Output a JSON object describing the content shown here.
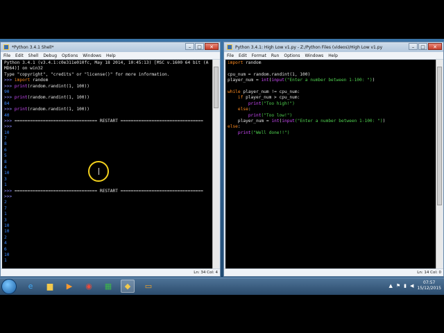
{
  "shell_window": {
    "title": "*Python 3.4.1 Shell*",
    "menu": [
      "File",
      "Edit",
      "Shell",
      "Debug",
      "Options",
      "Windows",
      "Help"
    ],
    "lines": [
      [
        [
          "t",
          "Python 3.4.1 (v3.4.1:c0e311e010fc, May 18 2014, 10:45:13) [MSC v.1600 64 bit (A"
        ]
      ],
      [
        [
          "t",
          "MD64)] on win32"
        ]
      ],
      [
        [
          "t",
          "Type \"copyright\", \"credits\" or \"license()\" for more information."
        ]
      ],
      [
        [
          "prompt",
          ">>> "
        ],
        [
          "kw",
          "import"
        ],
        [
          "t",
          " random"
        ]
      ],
      [
        [
          "prompt",
          ">>> "
        ],
        [
          "bi",
          "print"
        ],
        [
          "t",
          "(random.randint(1, 100))"
        ]
      ],
      [
        [
          "out",
          "90"
        ]
      ],
      [
        [
          "prompt",
          ">>> "
        ],
        [
          "bi",
          "print"
        ],
        [
          "t",
          "(random.randint(1, 100))"
        ]
      ],
      [
        [
          "out",
          "84"
        ]
      ],
      [
        [
          "prompt",
          ">>> "
        ],
        [
          "bi",
          "print"
        ],
        [
          "t",
          "(random.randint(1, 100))"
        ]
      ],
      [
        [
          "out",
          "40"
        ]
      ],
      [
        [
          "prompt",
          ">>> "
        ],
        [
          "t",
          "================================ RESTART ================================"
        ]
      ],
      [
        [
          "prompt",
          ">>> "
        ]
      ],
      [
        [
          "out",
          "10"
        ]
      ],
      [
        [
          "out",
          "7"
        ]
      ],
      [
        [
          "out",
          "8"
        ]
      ],
      [
        [
          "out",
          "6"
        ]
      ],
      [
        [
          "out",
          "5"
        ]
      ],
      [
        [
          "out",
          "8"
        ]
      ],
      [
        [
          "out",
          "4"
        ]
      ],
      [
        [
          "out",
          "10"
        ]
      ],
      [
        [
          "out",
          "3"
        ]
      ],
      [
        [
          "out",
          "1"
        ]
      ],
      [
        [
          "prompt",
          ">>> "
        ],
        [
          "t",
          "================================ RESTART ================================"
        ]
      ],
      [
        [
          "prompt",
          ">>> "
        ]
      ],
      [
        [
          "out",
          "2"
        ]
      ],
      [
        [
          "out",
          "7"
        ]
      ],
      [
        [
          "out",
          "1"
        ]
      ],
      [
        [
          "out",
          "3"
        ]
      ],
      [
        [
          "out",
          "10"
        ]
      ],
      [
        [
          "out",
          "10"
        ]
      ],
      [
        [
          "out",
          "2"
        ]
      ],
      [
        [
          "out",
          "4"
        ]
      ],
      [
        [
          "out",
          "6"
        ]
      ],
      [
        [
          "out",
          "10"
        ]
      ],
      [
        [
          "out",
          "1"
        ]
      ],
      [
        [
          "t",
          ""
        ]
      ],
      [
        [
          "prompt",
          ">>> "
        ]
      ]
    ],
    "status": "Ln: 34 Col: 4"
  },
  "editor_window": {
    "title": "Python 3.4.1: High Low v1.py - Z:/Python Files (videos)/High Low v1.py",
    "menu": [
      "File",
      "Edit",
      "Format",
      "Run",
      "Options",
      "Windows",
      "Help"
    ],
    "lines": [
      [
        [
          "kw",
          "import"
        ],
        [
          "t",
          " random"
        ]
      ],
      [
        [
          "t",
          ""
        ]
      ],
      [
        [
          "t",
          "cpu_num = random.randint(1, 100)"
        ]
      ],
      [
        [
          "t",
          "player_num = "
        ],
        [
          "bi",
          "int"
        ],
        [
          "t",
          "("
        ],
        [
          "bi",
          "input"
        ],
        [
          "str",
          "(\"Enter a number between 1-100: \")"
        ],
        [
          "t",
          ")"
        ]
      ],
      [
        [
          "t",
          ""
        ]
      ],
      [
        [
          "kw",
          "while"
        ],
        [
          "t",
          " player_num != cpu_num:"
        ]
      ],
      [
        [
          "t",
          "    "
        ],
        [
          "kw",
          "if"
        ],
        [
          "t",
          " player_num > cpu_num:"
        ]
      ],
      [
        [
          "t",
          "        "
        ],
        [
          "bi",
          "print"
        ],
        [
          "str",
          "(\"Too high!\")"
        ]
      ],
      [
        [
          "t",
          "    "
        ],
        [
          "kw",
          "else"
        ],
        [
          "t",
          ":"
        ]
      ],
      [
        [
          "t",
          "        "
        ],
        [
          "bi",
          "print"
        ],
        [
          "str",
          "(\"Too low!\")"
        ]
      ],
      [
        [
          "t",
          "    player_num = "
        ],
        [
          "bi",
          "int"
        ],
        [
          "t",
          "("
        ],
        [
          "bi",
          "input"
        ],
        [
          "str",
          "(\"Enter a number between 1-100: \")"
        ],
        [
          "t",
          ")"
        ]
      ],
      [
        [
          "kw",
          "else"
        ],
        [
          "t",
          ":"
        ]
      ],
      [
        [
          "t",
          "    "
        ],
        [
          "bi",
          "print"
        ],
        [
          "str",
          "(\"Well done!!\")"
        ]
      ],
      [
        [
          "t",
          ""
        ]
      ]
    ],
    "status": "Ln: 14 Col: 0"
  },
  "taskbar": {
    "apps": [
      {
        "name": "internet-explorer-icon",
        "glyph": "e",
        "color": "#3fa9f5"
      },
      {
        "name": "file-explorer-icon",
        "glyph": "▆",
        "color": "#f2c94c"
      },
      {
        "name": "media-player-icon",
        "glyph": "▶",
        "color": "#ff9a2e"
      },
      {
        "name": "chrome-icon",
        "glyph": "◉",
        "color": "#e84a3c"
      },
      {
        "name": "spreadsheet-icon",
        "glyph": "▦",
        "color": "#3cb44b"
      },
      {
        "name": "python-icon",
        "glyph": "◆",
        "color": "#f2c94c"
      },
      {
        "name": "folder-icon",
        "glyph": "▭",
        "color": "#f4a62a"
      }
    ],
    "clock_time": "07:57",
    "clock_date": "15/12/2015"
  },
  "colors": {
    "keyword": "#ff8b1f",
    "builtin": "#d04bff",
    "string": "#4fd14f",
    "output": "#3c8bff",
    "editor_bg": "#000000"
  }
}
